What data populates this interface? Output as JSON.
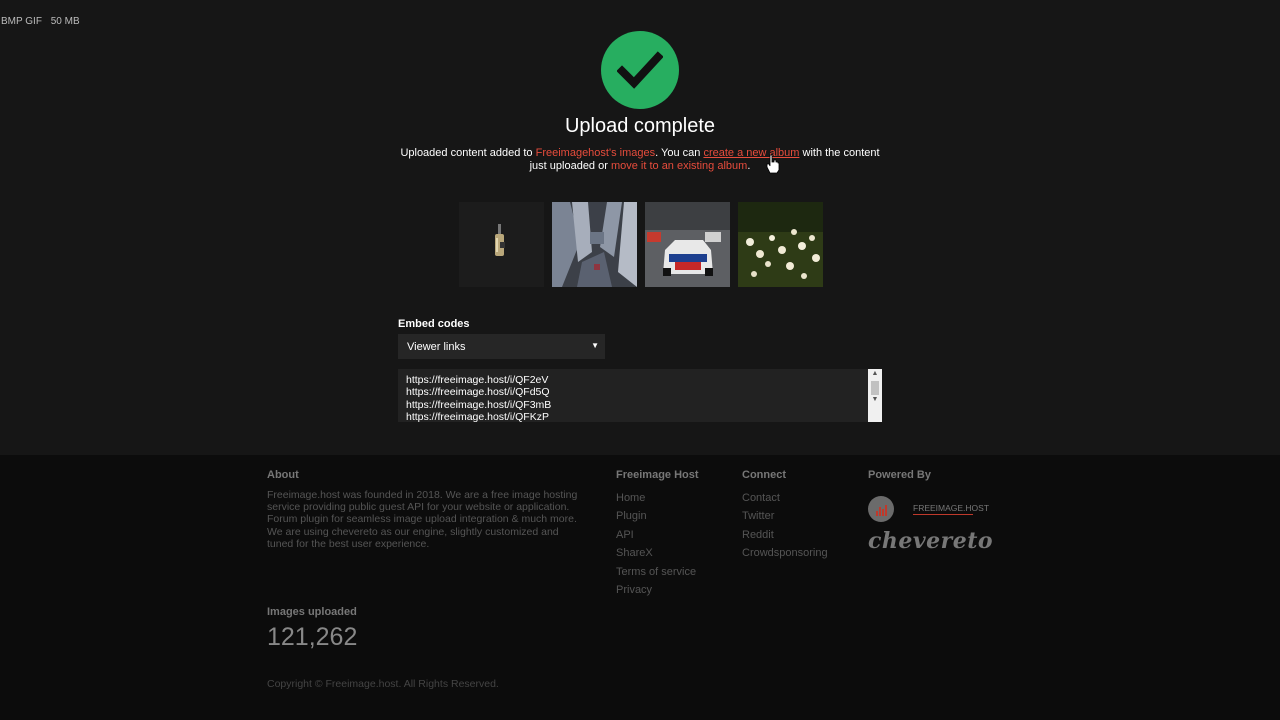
{
  "top_note": {
    "formats": "BMP GIF",
    "size_limit": "50 MB"
  },
  "upload": {
    "title": "Upload complete",
    "desc_prefix": "Uploaded content added to ",
    "desc_link1": "Freeimagehost's images",
    "desc_mid": ". You can ",
    "desc_link2": "create a new album",
    "desc_mid2": " with the content just uploaded or ",
    "desc_link3": "move it to an existing album",
    "desc_end": "."
  },
  "thumbnails": [
    {
      "name": "thumb-bottle",
      "alt": "bottle"
    },
    {
      "name": "thumb-city",
      "alt": "city aerial"
    },
    {
      "name": "thumb-racecar",
      "alt": "race car"
    },
    {
      "name": "thumb-flowers",
      "alt": "flowers"
    }
  ],
  "embed": {
    "label": "Embed codes",
    "selected": "Viewer links",
    "links": [
      "https://freeimage.host/i/QF2eV",
      "https://freeimage.host/i/QFd5Q",
      "https://freeimage.host/i/QF3mB",
      "https://freeimage.host/i/QFKzP"
    ]
  },
  "footer": {
    "about_title": "About",
    "about_text": "Freeimage.host was founded in 2018. We are a free image hosting service providing public guest API for your website or application. Forum plugin for seamless image upload integration & much more. We are using chevereto as our engine, slightly customized and tuned for the best user experience.",
    "host_title": "Freeimage Host",
    "host_links": [
      "Home",
      "Plugin",
      "API",
      "ShareX",
      "Terms of service",
      "Privacy"
    ],
    "connect_title": "Connect",
    "connect_links": [
      "Contact",
      "Twitter",
      "Reddit",
      "Crowdsponsoring"
    ],
    "powered_title": "Powered By",
    "logo_text": "FREEIMAGE.HOST",
    "engine_text": "chevereto",
    "images_label": "Images uploaded",
    "images_count": "121,262",
    "copyright": "Copyright © Freeimage.host. All Rights Reserved."
  },
  "colors": {
    "accent_green": "#27ae60",
    "link_red": "#e74c3c",
    "bg": "#161616",
    "footer_bg": "#0c0c0c"
  }
}
